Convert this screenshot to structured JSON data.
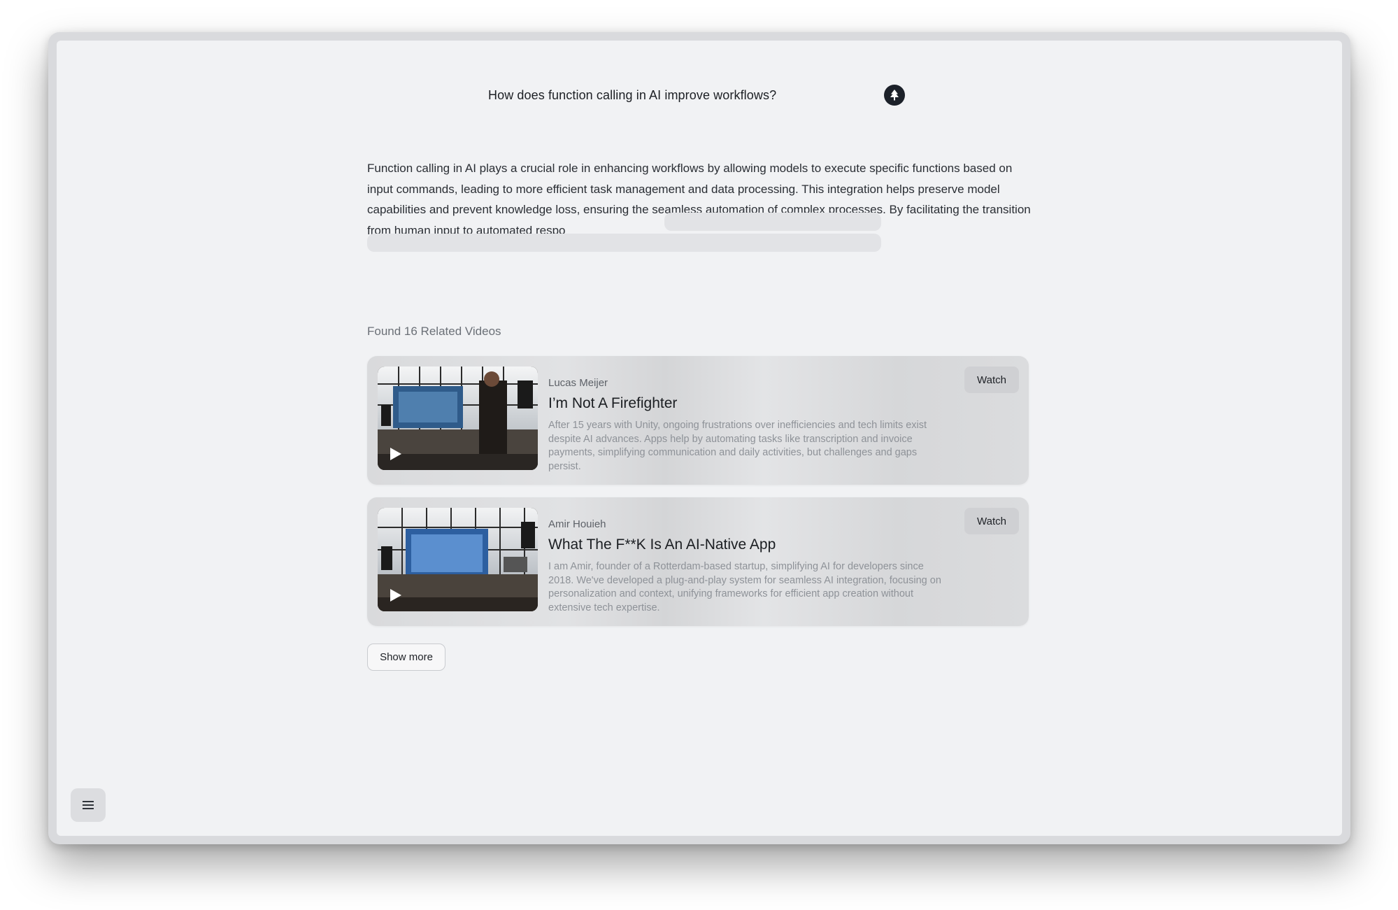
{
  "query": {
    "text": "How does function calling in AI improve workflows?",
    "submit_icon": "tree-icon"
  },
  "answer": {
    "text": "Function calling in AI plays a crucial role in enhancing workflows by allowing models to execute specific functions based on input commands, leading to more efficient task management and data processing. This integration helps preserve model capabilities and prevent knowledge loss, ensuring the seamless automation of complex processes. By facilitating the transition from human input to automated respo",
    "loading": true
  },
  "videos": {
    "heading": "Found 16 Related Videos",
    "items": [
      {
        "author": "Lucas Meijer",
        "title": "I’m Not A Firefighter",
        "description": "After 15 years with Unity, ongoing frustrations over inefficiencies and tech limits exist despite AI advances. Apps help by automating tasks like transcription and invoice payments, simplifying communication and daily activities, but challenges and gaps persist.",
        "watch_label": "Watch"
      },
      {
        "author": "Amir Houieh",
        "title": "What The F**K Is An AI-Native App",
        "description": "I am Amir, founder of a Rotterdam-based startup, simplifying AI for developers since 2018. We've developed a plug-and-play system for seamless AI integration, focusing on personalization and context, unifying frameworks for efficient app creation without extensive tech expertise.",
        "watch_label": "Watch"
      }
    ],
    "show_more_label": "Show more"
  },
  "menu": {
    "icon": "menu-icon"
  },
  "colors": {
    "background": "#f1f2f4",
    "card": "#dadbdd",
    "accent_dark": "#1c2129"
  }
}
